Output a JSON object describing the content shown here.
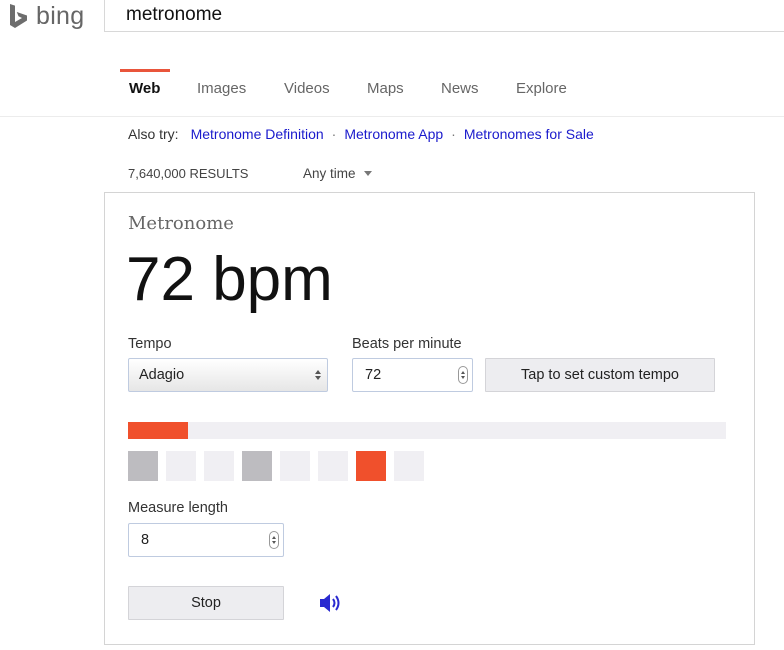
{
  "header": {
    "brand": "bing",
    "query": "metronome"
  },
  "tabs": [
    {
      "label": "Web",
      "active": true
    },
    {
      "label": "Images",
      "active": false
    },
    {
      "label": "Videos",
      "active": false
    },
    {
      "label": "Maps",
      "active": false
    },
    {
      "label": "News",
      "active": false
    },
    {
      "label": "Explore",
      "active": false
    }
  ],
  "also_try": {
    "label": "Also try:",
    "links": [
      "Metronome Definition",
      "Metronome App",
      "Metronomes for Sale"
    ]
  },
  "results": {
    "count": "7,640,000 RESULTS",
    "time_filter": "Any time"
  },
  "metronome": {
    "title": "Metronome",
    "display": "72 bpm",
    "tempo_label": "Tempo",
    "tempo_value": "Adagio",
    "bpm_label": "Beats per minute",
    "bpm_value": "72",
    "tap_label": "Tap to set custom tempo",
    "progress_fraction": 0.1,
    "beats": [
      "accent",
      "off",
      "off",
      "accent",
      "off",
      "off",
      "active",
      "off"
    ],
    "measure_label": "Measure length",
    "measure_value": "8",
    "stop_label": "Stop",
    "speaker_icon": "speaker-icon"
  },
  "colors": {
    "accent": "#f0502c",
    "link": "#1a1acc",
    "beat_accent": "#bdbcc0",
    "beat_off": "#f0eff3",
    "speaker": "#2a2ad0"
  }
}
